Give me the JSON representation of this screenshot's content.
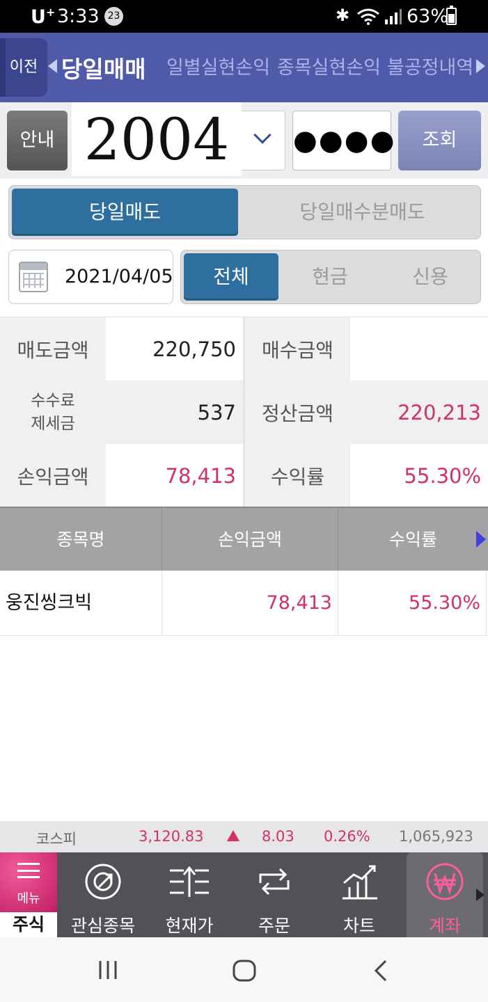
{
  "status_bar": {
    "carrier": "U",
    "carrier_mark": "+",
    "time": "3:33",
    "notification_count": "23",
    "battery": "63%"
  },
  "header": {
    "back_label": "이전",
    "tabs": [
      {
        "label": "당일매매",
        "active": true
      },
      {
        "label": "일별실현손익",
        "active": false
      },
      {
        "label": "종목실현손익",
        "active": false
      },
      {
        "label": "불공정내역",
        "active": false
      }
    ]
  },
  "query": {
    "guide_label": "안내",
    "account_number": "2004",
    "password_mask": "●●●●",
    "query_label": "조회"
  },
  "trade_type": {
    "options": [
      "당일매도",
      "당일매수분매도"
    ],
    "selected": "당일매도"
  },
  "date": "2021/04/05",
  "settlement_type": {
    "options": [
      "전체",
      "현금",
      "신용"
    ],
    "selected": "전체"
  },
  "summary": {
    "sell_amount_label": "매도금액",
    "sell_amount": "220,750",
    "buy_amount_label": "매수금액",
    "buy_amount": "",
    "fee_label_line1": "수수료",
    "fee_label_line2": "제세금",
    "fee": "537",
    "settle_label": "정산금액",
    "settle_amount": "220,213",
    "pnl_label": "손익금액",
    "pnl": "78,413",
    "return_label": "수익률",
    "return_rate": "55.30%"
  },
  "table": {
    "headers": [
      "종목명",
      "손익금액",
      "수익률"
    ],
    "rows": [
      {
        "name": "웅진씽크빅",
        "pnl": "78,413",
        "return_rate": "55.30%"
      }
    ]
  },
  "ticker": {
    "index_name": "코스피",
    "value": "3,120.83",
    "change": "8.03",
    "change_pct": "0.26%",
    "volume": "1,065,923"
  },
  "bottom_nav": {
    "menu_label": "메뉴",
    "market_label": "주식",
    "items": [
      {
        "label": "관심종목",
        "icon": "watchlist-icon"
      },
      {
        "label": "현재가",
        "icon": "price-icon"
      },
      {
        "label": "주문",
        "icon": "order-icon"
      },
      {
        "label": "차트",
        "icon": "chart-icon"
      },
      {
        "label": "계좌",
        "icon": "won-account-icon"
      }
    ],
    "active": "계좌"
  },
  "colors": {
    "header_bg": "#4f5aa8",
    "accent_blue": "#2f6f9f",
    "profit_pink": "#d2306b",
    "nav_bg": "#525256"
  }
}
